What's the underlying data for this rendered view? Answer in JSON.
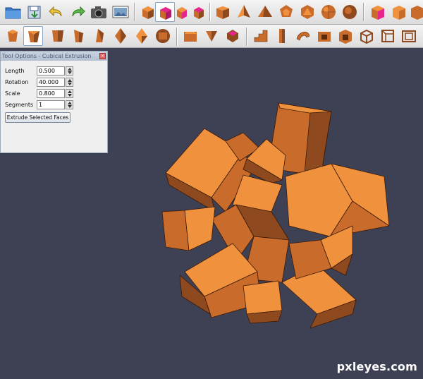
{
  "toolbar": {
    "row1": [
      {
        "name": "open-folder-icon"
      },
      {
        "name": "save-icon"
      },
      {
        "name": "undo-icon"
      },
      {
        "name": "redo-icon"
      },
      {
        "name": "camera-icon"
      },
      {
        "name": "screenshot-icon"
      },
      {
        "name": "cube-icon"
      },
      {
        "name": "cube-selected-face-icon",
        "active": true
      },
      {
        "name": "cube-small-icon"
      },
      {
        "name": "cube-pink-face-icon"
      },
      {
        "name": "box-icon"
      },
      {
        "name": "tetrahedron-icon"
      },
      {
        "name": "pyramid-icon"
      },
      {
        "name": "dodecahedron-icon"
      },
      {
        "name": "icosahedron-icon"
      },
      {
        "name": "sphere-icon"
      },
      {
        "name": "sphere-dense-icon"
      },
      {
        "name": "cube-magenta-icon"
      },
      {
        "name": "cube-orange-icon"
      },
      {
        "name": "cube-flat-icon"
      }
    ],
    "row2": [
      {
        "name": "cube-extrude-icon"
      },
      {
        "name": "cubical-extrusion-icon",
        "active": true
      },
      {
        "name": "prism-icon"
      },
      {
        "name": "wedge-icon"
      },
      {
        "name": "pyramid-extrude-icon"
      },
      {
        "name": "octahedron-icon"
      },
      {
        "name": "cuboctahedron-icon"
      },
      {
        "name": "bevel-icon"
      },
      {
        "name": "truncate-icon"
      },
      {
        "name": "select-face-icon"
      },
      {
        "name": "stair-icon"
      },
      {
        "name": "column-icon"
      },
      {
        "name": "twist-icon"
      },
      {
        "name": "hollow-box-icon"
      },
      {
        "name": "hollow-cube-icon"
      },
      {
        "name": "wire-cube-icon"
      },
      {
        "name": "wire-cube-2-icon"
      },
      {
        "name": "wire-cube-3-icon"
      }
    ]
  },
  "panel": {
    "title": "Tool Options - Cubical Extrusion",
    "close": "×",
    "fields": [
      {
        "label": "Length",
        "value": "0.500"
      },
      {
        "label": "Rotation",
        "value": "40.000"
      },
      {
        "label": "Scale",
        "value": "0.800"
      },
      {
        "label": "Segments",
        "value": "1"
      }
    ],
    "button": "Extrude Selected Faces"
  },
  "colors": {
    "viewport_bg": "#3e4154",
    "face_light": "#f0913d",
    "face_mid": "#c96b2b",
    "face_dark": "#8e4a1e",
    "selected_face": "#e6268c"
  },
  "watermark": "pxleyes.com"
}
